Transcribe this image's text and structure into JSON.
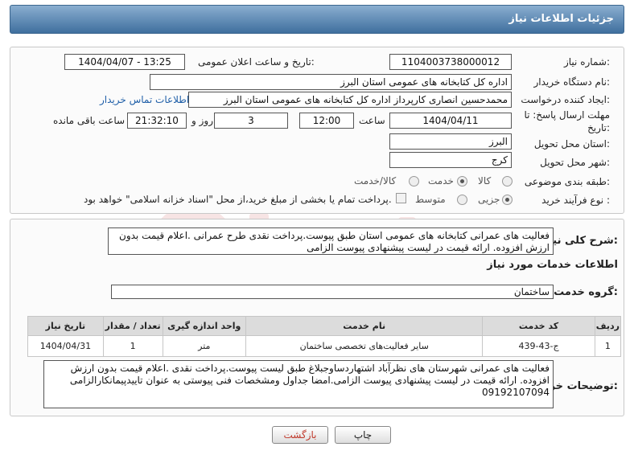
{
  "header": {
    "title": "جزئیات اطلاعات نیاز"
  },
  "form": {
    "need_number": {
      "label": "شماره نیاز:",
      "value": "1104003738000012"
    },
    "announce_datetime": {
      "label": "تاریخ و ساعت اعلان عمومی:",
      "value": "1404/04/07 - 13:25"
    },
    "buyer_org": {
      "label": "نام دستگاه خریدار:",
      "value": "اداره کل کتابخانه های عمومی استان البرز"
    },
    "creator": {
      "label": "ایجاد کننده درخواست:",
      "value": "محمدحسین انصاری کارپرداز اداره کل کتابخانه های عمومی استان البرز",
      "contact_link": "اطلاعات تماس خریدار"
    },
    "deadline": {
      "label_line1": "مهلت ارسال پاسخ: تا",
      "label_line2": "تاریخ:",
      "date": "1404/04/11",
      "time_label": "ساعت",
      "time": "12:00",
      "days": "3",
      "days_label": "روز و",
      "remaining": "21:32:10",
      "remaining_label": "ساعت باقی مانده"
    },
    "delivery_province": {
      "label": "استان محل تحویل:",
      "value": "البرز"
    },
    "delivery_city": {
      "label": "شهر محل تحویل:",
      "value": "کرج"
    },
    "category": {
      "label": "طبقه بندی موضوعی:",
      "options": [
        "کالا",
        "خدمت",
        "کالا/خدمت"
      ],
      "selected": "خدمت"
    },
    "purchase_type": {
      "label": "نوع فرآیند خرید :",
      "options": [
        "جزیی",
        "متوسط"
      ],
      "selected": "جزیی",
      "treasury_note": "پرداخت تمام یا بخشی از مبلغ خرید،از محل \"اسناد خزانه اسلامی\" خواهد بود."
    }
  },
  "summary": {
    "label": "شرح کلی نیاز:",
    "text": "فعالیت های عمرانی کتابخانه های عمومی استان طبق پیوست.پرداخت نقدی طرح عمرانی .اعلام قیمت بدون ارزش افزوده. ارائه قیمت در لیست پیشنهادی پیوست الزامی"
  },
  "services": {
    "section_title": "اطلاعات خدمات مورد نیاز",
    "group_label": "گروه خدمت:",
    "group_value": "ساختمان",
    "columns": [
      "ردیف",
      "کد خدمت",
      "نام خدمت",
      "واحد اندازه گیری",
      "تعداد / مقدار",
      "تاریخ نیاز"
    ],
    "rows": [
      [
        "1",
        "ج-43-439",
        "سایر فعالیت‌های تخصصی ساختمان",
        "متر",
        "1",
        "1404/04/31"
      ]
    ]
  },
  "buyer_notes": {
    "label": "توضیحات خریدار:",
    "text": "فعالیت های عمرانی شهرستان های نظرآباد اشتهاردساوجبلاغ طبق لیست پیوست.پرداخت نقدی .اعلام قیمت بدون ارزش افزوده. ارائه قیمت در لیست پیشنهادی پیوست الزامی.امضا جداول ومشخصات فنی پیوستی به عنوان تاییدپیمانکارالزامی 09192107094"
  },
  "buttons": {
    "print": "چاپ",
    "back": "بازگشت"
  },
  "colors": {
    "header_top": "#8aaed0",
    "header_bottom": "#3f6f9e",
    "link": "#1f5fa8",
    "back_text": "#c0392b"
  }
}
